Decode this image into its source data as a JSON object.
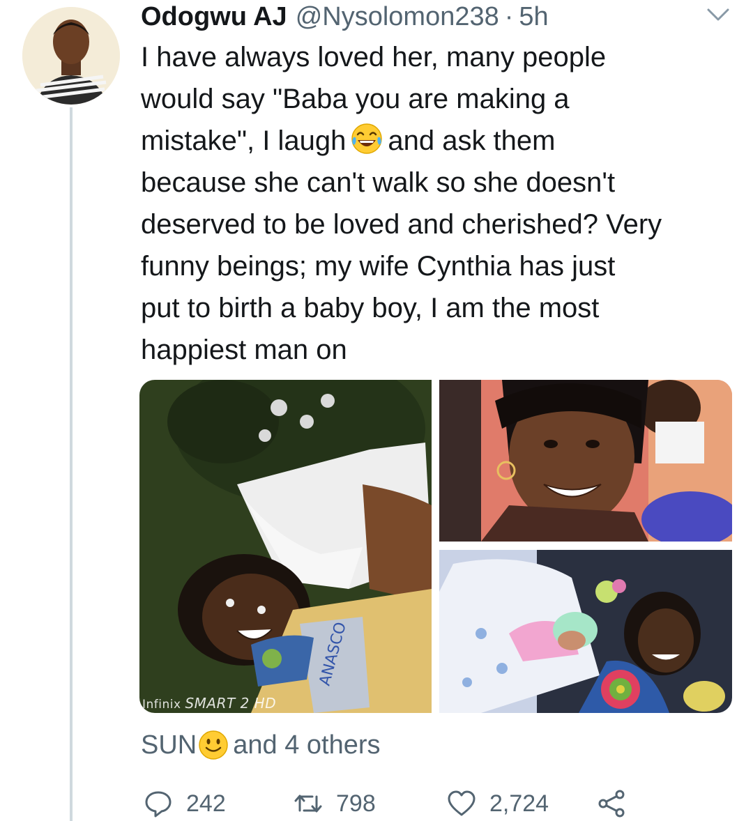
{
  "tweet": {
    "author_name": "Odogwu AJ",
    "handle": "@Nysolomon238",
    "separator": "·",
    "time": "5h",
    "text_lines": [
      "I have always loved her, many people",
      "would say \"Baba you are making a",
      "mistake\", I laugh",
      "and ask them",
      "because she can't walk so she doesn't",
      "deserved to be loved and cherished? Very",
      "funny beings; my wife Cynthia has just",
      "put to birth a baby boy, I am the most",
      "happiest man on"
    ],
    "inline_emoji": "face-with-tears-of-joy-icon",
    "media": {
      "photo_count": 3,
      "watermark_brand": "Infinix",
      "watermark_model": "SMART 2 HD",
      "bag_text": "ANASCO"
    }
  },
  "social_context": {
    "liker_name": "SUN",
    "liker_emoji": "smiling-face-icon",
    "others_text": "and 4 others"
  },
  "actions": {
    "reply_count": "242",
    "retweet_count": "798",
    "like_count": "2,724"
  },
  "colors": {
    "text_primary": "#14171a",
    "text_secondary": "#536471",
    "thread_line": "#cfd9de",
    "emoji_yellow": "#ffcc33"
  }
}
